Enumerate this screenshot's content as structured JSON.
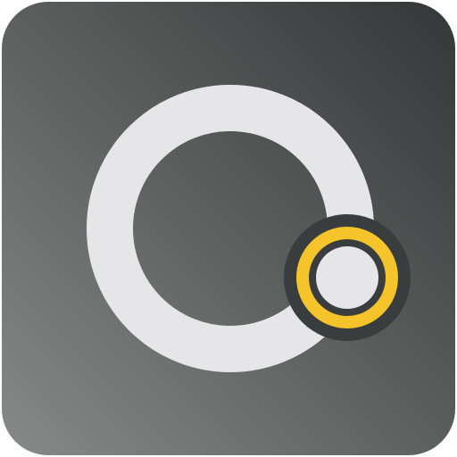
{
  "icon": {
    "name": "app-icon",
    "glyph": "ring-with-dot-icon",
    "colors": {
      "tile_gradient_light": "#868a89",
      "tile_gradient_mid": "#5b5f5e",
      "tile_gradient_dark": "#343738",
      "ring": "#e6e6e8",
      "accent_ring": "#f5c42a",
      "accent_ring_outline": "#3a3d3e",
      "dot": "#e6e6e8"
    }
  }
}
